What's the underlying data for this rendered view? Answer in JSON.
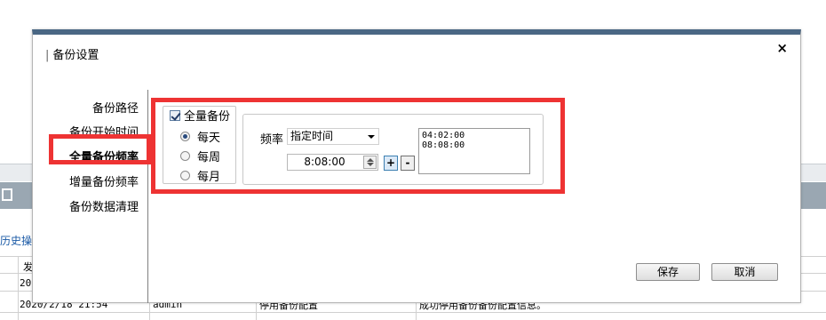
{
  "background": {
    "history_label": "历史操作",
    "rows": [
      {
        "c1": "发",
        "c2": "",
        "c3": "",
        "c4": ""
      },
      {
        "c1": "202",
        "c2": "",
        "c3": "",
        "c4": ""
      },
      {
        "c1": "2020/2/18 21:54",
        "c2": "admin",
        "c3": "停用备份配置",
        "c4": "成功停用备份备份配置信息。"
      },
      {
        "c1": "",
        "c2": "",
        "c3": "",
        "c4": ""
      }
    ]
  },
  "dialog": {
    "title": "备份设置",
    "close_glyph": "×",
    "nav": [
      {
        "label": "备份路径"
      },
      {
        "label": "备份开始时间"
      },
      {
        "label": "全量备份频率",
        "active": true
      },
      {
        "label": "增量备份频率"
      },
      {
        "label": "备份数据清理"
      }
    ],
    "full_backup_label": "全量备份",
    "full_backup_checked": true,
    "radios": [
      {
        "label": "每天",
        "checked": true
      },
      {
        "label": "每周",
        "checked": false
      },
      {
        "label": "每月",
        "checked": false
      }
    ],
    "frequency_label": "频率",
    "frequency_value": "指定时间",
    "time_value": "8:08:00",
    "plus_label": "+",
    "minus_label": "-",
    "times": [
      "04:02:00",
      "08:08:00"
    ],
    "save_label": "保存",
    "cancel_label": "取消"
  },
  "colors": {
    "highlight": "#ee3333",
    "title_bar": "#4a6784"
  }
}
